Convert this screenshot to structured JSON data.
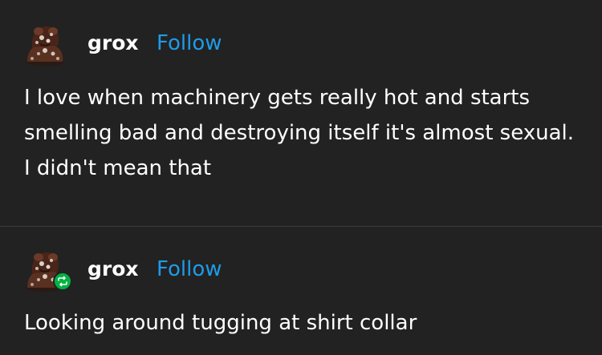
{
  "colors": {
    "background": "#222222",
    "text": "#ffffff",
    "follow": "#1e9be9",
    "reblog_badge": "#00b341",
    "divider": "#3a3a3a"
  },
  "posts": [
    {
      "username": "grox",
      "follow_label": "Follow",
      "avatar_icon": "avatar-image",
      "text": "I love when machinery gets really hot and starts smelling bad and destroying itself it's almost sexual. I didn't mean that"
    },
    {
      "username": "grox",
      "follow_label": "Follow",
      "avatar_icon": "avatar-image",
      "badge_icon": "reblog-icon",
      "text": "Looking around tugging at shirt collar"
    }
  ]
}
